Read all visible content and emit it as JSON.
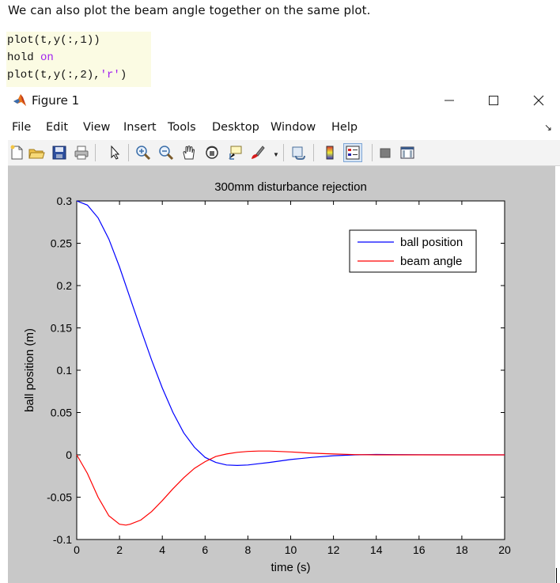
{
  "intro_text": "We can also plot the beam angle together on the same plot.",
  "code": {
    "line1": "plot(t,y(:,1))",
    "line2_cmd": "hold ",
    "line2_kw": "on",
    "line3_pre": "plot(t,y(:,2),",
    "line3_str": "'r'",
    "line3_post": ")"
  },
  "window": {
    "title": "Figure 1",
    "icon": "matlab-logo-icon",
    "controls": [
      "minimize-icon",
      "maximize-icon",
      "close-icon"
    ]
  },
  "menu": {
    "items": [
      "File",
      "Edit",
      "View",
      "Insert",
      "Tools",
      "Desktop",
      "Window",
      "Help"
    ],
    "dock_icon": "dock-arrow-icon"
  },
  "toolbar": {
    "buttons": [
      "new-figure-icon",
      "open-file-icon",
      "save-icon",
      "print-icon",
      "edit-plot-arrow-icon",
      "zoom-in-icon",
      "zoom-out-icon",
      "pan-hand-icon",
      "rotate-3d-icon",
      "data-cursor-icon",
      "brush-icon",
      "link-plot-icon",
      "colorbar-icon",
      "legend-icon",
      "hide-plot-tools-icon",
      "show-plot-tools-icon"
    ]
  },
  "colors": {
    "blue": "#0000ff",
    "red": "#ff0000",
    "figure_bg": "#c8c8c8"
  },
  "chart_data": {
    "type": "line",
    "title": "300mm disturbance rejection",
    "xlabel": "time (s)",
    "ylabel": "ball position (m)",
    "xlim": [
      0,
      20
    ],
    "ylim": [
      -0.1,
      0.3
    ],
    "xticks": [
      "0",
      "2",
      "4",
      "6",
      "8",
      "10",
      "12",
      "14",
      "16",
      "18",
      "20"
    ],
    "yticks": [
      "-0.1",
      "-0.05",
      "0",
      "0.05",
      "0.1",
      "0.15",
      "0.2",
      "0.25",
      "0.3"
    ],
    "legend_placement": "top-right",
    "grid": false,
    "series": [
      {
        "name": "ball position",
        "color": "#0000ff",
        "x": [
          0,
          0.5,
          1,
          1.5,
          2,
          2.5,
          3,
          3.5,
          4,
          4.5,
          5,
          5.5,
          6,
          6.5,
          7,
          7.5,
          8,
          8.5,
          9,
          10,
          11,
          12,
          13,
          14,
          15,
          16,
          18,
          20
        ],
        "y": [
          0.3,
          0.295,
          0.28,
          0.255,
          0.222,
          0.185,
          0.148,
          0.112,
          0.079,
          0.05,
          0.026,
          0.009,
          -0.003,
          -0.009,
          -0.012,
          -0.0125,
          -0.012,
          -0.0105,
          -0.009,
          -0.0055,
          -0.003,
          -0.001,
          0.0,
          0.0005,
          0.0003,
          0.0001,
          0.0,
          0.0
        ]
      },
      {
        "name": "beam angle",
        "color": "#ff0000",
        "x": [
          0,
          0.5,
          1,
          1.5,
          2,
          2.3,
          2.5,
          3,
          3.5,
          4,
          4.5,
          5,
          5.5,
          6,
          6.5,
          7,
          7.5,
          8,
          8.5,
          9,
          10,
          11,
          12,
          13,
          14,
          16,
          18,
          20
        ],
        "y": [
          0.0,
          -0.022,
          -0.05,
          -0.072,
          -0.082,
          -0.083,
          -0.082,
          -0.077,
          -0.067,
          -0.054,
          -0.04,
          -0.027,
          -0.016,
          -0.008,
          -0.002,
          0.001,
          0.003,
          0.004,
          0.0045,
          0.0045,
          0.0035,
          0.002,
          0.001,
          0.0003,
          0.0,
          0.0,
          0.0,
          0.0
        ]
      }
    ]
  }
}
